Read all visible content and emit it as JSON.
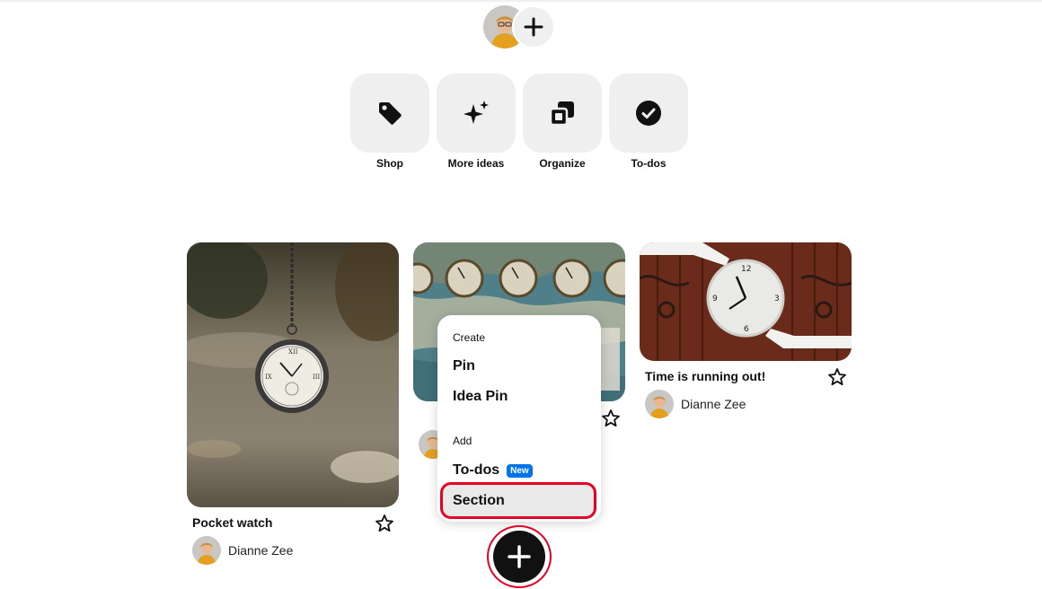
{
  "tiles": [
    {
      "label": "Shop",
      "icon": "tag-icon"
    },
    {
      "label": "More ideas",
      "icon": "sparkle-icon"
    },
    {
      "label": "Organize",
      "icon": "organize-icon"
    },
    {
      "label": "To-dos",
      "icon": "check-circle-icon"
    }
  ],
  "pins": [
    {
      "title": "Pocket watch",
      "author": "Dianne Zee"
    },
    {
      "title": "",
      "author": ""
    },
    {
      "title": "Time is running out!",
      "author": "Dianne Zee"
    }
  ],
  "menu": {
    "create_heading": "Create",
    "pin": "Pin",
    "idea_pin": "Idea Pin",
    "add_heading": "Add",
    "todos": "To-dos",
    "new_badge": "New",
    "section": "Section"
  },
  "colors": {
    "highlight": "#e60023",
    "badge": "#0074e8",
    "tile_bg": "#efefef"
  }
}
